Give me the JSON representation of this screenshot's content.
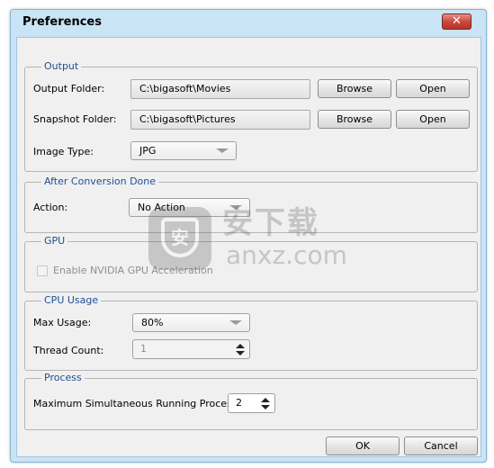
{
  "window": {
    "title": "Preferences",
    "close_glyph": "✕"
  },
  "output": {
    "legend": "Output",
    "output_folder_label": "Output Folder:",
    "output_folder_value": "C:\\bigasoft\\Movies",
    "snapshot_folder_label": "Snapshot Folder:",
    "snapshot_folder_value": "C:\\bigasoft\\Pictures",
    "browse_label": "Browse",
    "open_label": "Open",
    "image_type_label": "Image Type:",
    "image_type_value": "JPG"
  },
  "after_conversion": {
    "legend": "After Conversion Done",
    "action_label": "Action:",
    "action_value": "No Action"
  },
  "gpu": {
    "legend": "GPU",
    "nvidia_label": "Enable NVIDIA GPU Acceleration",
    "nvidia_checked": false
  },
  "cpu": {
    "legend": "CPU Usage",
    "max_usage_label": "Max Usage:",
    "max_usage_value": "80%",
    "thread_count_label": "Thread Count:",
    "thread_count_value": "1"
  },
  "process": {
    "legend": "Process",
    "max_processes_label": "Maximum Simultaneous Running Processes:",
    "max_processes_value": "2"
  },
  "footer": {
    "ok_label": "OK",
    "cancel_label": "Cancel"
  },
  "watermark": {
    "cn_text": "安下载",
    "en_text": "anxz.com",
    "shield_glyph": "安"
  },
  "icons": {
    "close": "close-icon",
    "dropdown": "chevron-down-icon",
    "spin": "spin-updown-icon"
  },
  "colors": {
    "frame": "#c8e4f5",
    "legend_text": "#1c4f96",
    "close_button": "#c9443a"
  }
}
